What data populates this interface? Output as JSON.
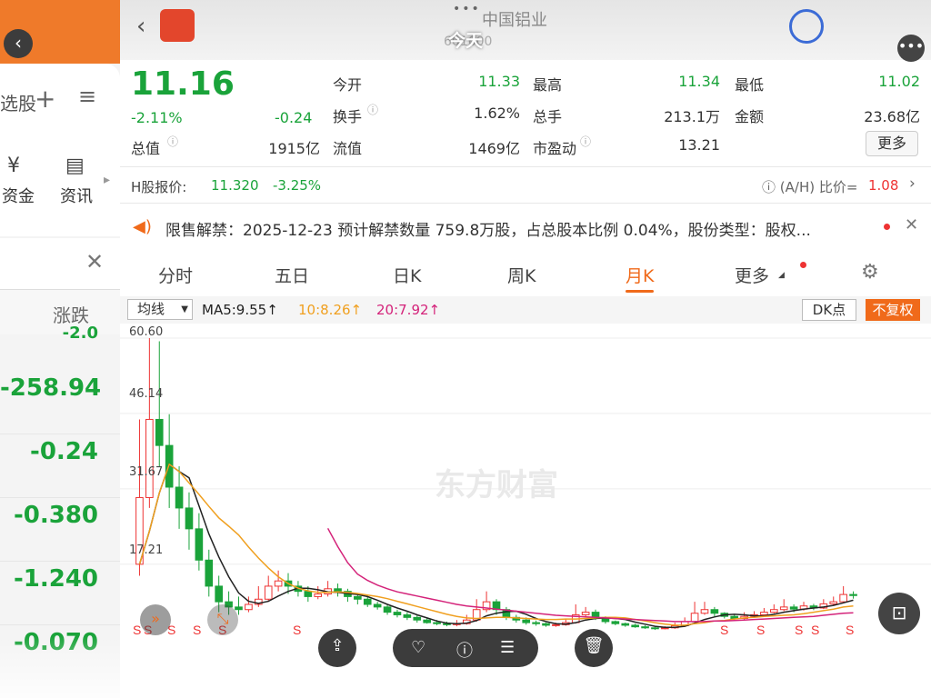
{
  "left_app": {
    "tab_fragment": "选股",
    "icon_funds": "资金",
    "icon_news": "资讯",
    "col_header": "涨跌",
    "values": [
      "-258.94",
      "-0.24",
      "-0.380",
      "-1.240",
      "-0.070"
    ],
    "partial_top_value": "-2.0"
  },
  "header": {
    "title": "今天",
    "stock_name": "中国铝业",
    "stock_code": "601600",
    "sub_code": "601600"
  },
  "quote": {
    "price": "11.16",
    "pct": "-2.11%",
    "change": "-0.24",
    "rows": [
      [
        {
          "label": "今开",
          "value": "11.33",
          "green": true
        },
        {
          "label": "最高",
          "value": "11.34",
          "green": true
        },
        {
          "label": "最低",
          "value": "11.02",
          "green": true
        }
      ],
      [
        {
          "label": "换手",
          "value": "1.62%",
          "green": false
        },
        {
          "label": "总手",
          "value": "213.1万",
          "green": false
        },
        {
          "label": "金额",
          "value": "23.68亿",
          "green": false
        }
      ]
    ],
    "total_value_label": "总值",
    "total_value": "1915亿",
    "float_label": "流值",
    "float_value": "1469亿",
    "pe_label": "市盈动",
    "pe_value": "13.21",
    "more_label": "更多"
  },
  "hshare": {
    "label": "H股报价:",
    "price": "11.320",
    "pct": "-3.25%",
    "ratio_label": "(A/H) 比价=",
    "ratio_value": "1.08"
  },
  "notice": {
    "text": "限售解禁：2025-12-23 预计解禁数量 759.8万股，占总股本比例 0.04%，股份类型：股权..."
  },
  "tabs": [
    "分时",
    "五日",
    "日K",
    "周K",
    "月K",
    "更多"
  ],
  "active_tab": "月K",
  "ma": {
    "selector": "均线",
    "ma5": "MA5:9.55",
    "ma10": "10:8.26",
    "ma20": "20:7.92",
    "dk_label": "DK点",
    "fq_label": "不复权"
  },
  "chart_labels": {
    "watermark": "东方财富",
    "y_ticks": [
      "60.60",
      "46.14",
      "31.67",
      "17.21"
    ],
    "marks": [
      "S",
      "S",
      "S",
      "S",
      "S",
      "S",
      "S",
      "S",
      "S",
      "S",
      "S"
    ]
  },
  "colors": {
    "green": "#1aa33a",
    "red": "#e33",
    "orange": "#f06a1a",
    "ma5": "#222222",
    "ma10": "#f0a020",
    "ma20": "#d4237a"
  },
  "chart_data": {
    "type": "candlestick",
    "ylim": [
      2,
      62
    ],
    "candles": [
      [
        17.2,
        30.0,
        45.0,
        15.0
      ],
      [
        30.0,
        45.0,
        60.6,
        28.0
      ],
      [
        45.0,
        40.0,
        60.0,
        36.0
      ],
      [
        40.0,
        32.0,
        46.0,
        28.0
      ],
      [
        32.0,
        28.0,
        36.0,
        24.0
      ],
      [
        28.0,
        24.0,
        31.0,
        20.0
      ],
      [
        24.0,
        18.0,
        27.0,
        16.0
      ],
      [
        18.0,
        13.0,
        20.0,
        11.0
      ],
      [
        13.0,
        10.0,
        15.0,
        8.0
      ],
      [
        10.0,
        9.0,
        12.0,
        7.5
      ],
      [
        9.0,
        8.5,
        11.0,
        7.5
      ],
      [
        8.5,
        9.5,
        11.0,
        8.0
      ],
      [
        9.5,
        10.5,
        13.0,
        9.0
      ],
      [
        10.5,
        13.0,
        15.0,
        10.0
      ],
      [
        13.0,
        14.0,
        16.0,
        12.0
      ],
      [
        14.0,
        13.0,
        15.5,
        11.5
      ],
      [
        13.0,
        12.0,
        14.0,
        11.0
      ],
      [
        12.0,
        11.0,
        13.0,
        10.0
      ],
      [
        11.0,
        11.5,
        13.0,
        10.5
      ],
      [
        11.5,
        12.5,
        14.0,
        11.0
      ],
      [
        12.5,
        12.0,
        13.5,
        11.0
      ],
      [
        12.0,
        11.0,
        12.5,
        10.0
      ],
      [
        11.0,
        10.5,
        11.5,
        9.5
      ],
      [
        10.5,
        9.5,
        11.0,
        9.0
      ],
      [
        9.5,
        9.0,
        10.0,
        8.5
      ],
      [
        9.0,
        8.0,
        9.5,
        7.5
      ],
      [
        8.0,
        7.5,
        8.5,
        7.0
      ],
      [
        7.5,
        7.0,
        8.0,
        6.5
      ],
      [
        7.0,
        6.5,
        7.5,
        6.0
      ],
      [
        6.5,
        6.0,
        7.0,
        5.8
      ],
      [
        6.0,
        5.8,
        6.5,
        5.5
      ],
      [
        5.8,
        5.6,
        6.2,
        5.3
      ],
      [
        5.6,
        5.8,
        6.5,
        5.3
      ],
      [
        5.8,
        6.5,
        7.5,
        5.6
      ],
      [
        6.5,
        8.5,
        10.5,
        6.2
      ],
      [
        8.5,
        10.0,
        12.0,
        8.0
      ],
      [
        10.0,
        8.5,
        10.5,
        7.5
      ],
      [
        8.5,
        7.0,
        9.0,
        6.5
      ],
      [
        7.0,
        6.5,
        7.5,
        6.0
      ],
      [
        6.5,
        6.0,
        7.0,
        5.6
      ],
      [
        6.0,
        5.8,
        6.4,
        5.4
      ],
      [
        5.8,
        5.5,
        6.0,
        5.2
      ],
      [
        5.5,
        5.6,
        6.0,
        5.2
      ],
      [
        5.6,
        6.0,
        6.8,
        5.4
      ],
      [
        6.0,
        7.5,
        9.5,
        5.8
      ],
      [
        7.5,
        8.0,
        9.0,
        7.0
      ],
      [
        8.0,
        7.0,
        8.5,
        6.5
      ],
      [
        7.0,
        6.2,
        7.2,
        5.8
      ],
      [
        6.2,
        5.8,
        6.4,
        5.5
      ],
      [
        5.8,
        5.5,
        6.0,
        5.2
      ],
      [
        5.5,
        5.2,
        5.8,
        5.0
      ],
      [
        5.2,
        5.0,
        5.5,
        4.8
      ],
      [
        5.0,
        4.9,
        5.2,
        4.6
      ],
      [
        4.9,
        5.0,
        5.3,
        4.7
      ],
      [
        5.0,
        5.4,
        6.0,
        4.8
      ],
      [
        5.4,
        6.2,
        7.0,
        5.2
      ],
      [
        6.2,
        7.8,
        10.0,
        6.0
      ],
      [
        7.8,
        8.5,
        10.0,
        7.5
      ],
      [
        8.5,
        7.8,
        9.0,
        7.2
      ],
      [
        7.8,
        7.2,
        8.0,
        6.8
      ],
      [
        7.2,
        6.8,
        7.5,
        6.4
      ],
      [
        6.8,
        7.2,
        8.0,
        6.5
      ],
      [
        7.2,
        7.5,
        8.2,
        7.0
      ],
      [
        7.5,
        8.0,
        8.8,
        7.2
      ],
      [
        8.0,
        8.5,
        9.5,
        7.8
      ],
      [
        8.5,
        9.0,
        10.5,
        8.2
      ],
      [
        9.0,
        8.6,
        9.5,
        8.0
      ],
      [
        8.6,
        9.2,
        10.0,
        8.3
      ],
      [
        9.2,
        8.8,
        9.6,
        8.4
      ],
      [
        8.8,
        9.6,
        10.5,
        8.6
      ],
      [
        9.6,
        10.0,
        11.0,
        9.3
      ],
      [
        10.0,
        11.4,
        13.0,
        9.8
      ],
      [
        11.4,
        11.2,
        12.0,
        10.6
      ]
    ],
    "ma_series": [
      {
        "name": "MA5",
        "values": [
          17.2,
          23.6,
          30.9,
          36.4,
          35.0,
          33.8,
          28.4,
          23.0,
          18.6,
          14.8,
          11.7,
          10.1,
          9.7,
          10.1,
          11.1,
          12.0,
          12.6,
          12.6,
          12.3,
          11.9,
          11.8,
          11.6,
          11.4,
          11.0,
          10.3,
          9.5,
          8.8,
          8.2,
          7.5,
          6.9,
          6.3,
          5.9,
          5.8,
          5.9,
          6.4,
          7.3,
          7.8,
          8.1,
          8.2,
          7.6,
          6.8,
          6.2,
          5.8,
          5.7,
          6.0,
          6.5,
          6.8,
          6.9,
          6.8,
          6.6,
          6.1,
          5.7,
          5.3,
          5.1,
          5.1,
          5.3,
          5.9,
          6.6,
          7.1,
          7.5,
          7.6,
          7.5,
          7.3,
          7.3,
          7.6,
          8.0,
          8.3,
          8.6,
          8.8,
          9.0,
          9.3,
          9.8,
          10.3
        ]
      },
      {
        "name": "MA10",
        "values": [
          17.2,
          23.6,
          30.9,
          36.4,
          35.0,
          32.8,
          30.6,
          28.3,
          26.1,
          24.5,
          22.8,
          20.5,
          18.4,
          16.5,
          14.8,
          13.5,
          12.6,
          12.1,
          11.8,
          11.8,
          11.9,
          11.8,
          11.6,
          11.3,
          11.0,
          10.6,
          10.1,
          9.6,
          9.1,
          8.6,
          8.1,
          7.6,
          7.2,
          6.9,
          6.8,
          6.9,
          7.0,
          7.0,
          6.9,
          6.8,
          6.7,
          6.6,
          6.6,
          6.7,
          6.7,
          6.8,
          6.9,
          7.0,
          7.0,
          6.9,
          6.6,
          6.3,
          6.0,
          5.7,
          5.5,
          5.5,
          5.8,
          6.0,
          6.3,
          6.4,
          6.7,
          6.9,
          7.0,
          7.2,
          7.3,
          7.4,
          7.5,
          7.7,
          8.0,
          8.3,
          8.6,
          9.0,
          9.2
        ]
      },
      {
        "name": "MA20",
        "values": [
          null,
          null,
          null,
          null,
          null,
          null,
          null,
          null,
          null,
          null,
          null,
          null,
          null,
          null,
          null,
          null,
          null,
          null,
          null,
          24.1,
          20.6,
          17.5,
          15.3,
          14.1,
          13.2,
          12.5,
          11.9,
          11.5,
          11.1,
          10.7,
          10.3,
          9.9,
          9.5,
          9.2,
          9.0,
          8.8,
          8.6,
          8.4,
          8.2,
          8.0,
          7.8,
          7.6,
          7.4,
          7.3,
          7.2,
          7.1,
          7.0,
          6.9,
          6.8,
          6.7,
          6.6,
          6.5,
          6.4,
          6.3,
          6.2,
          6.2,
          6.2,
          6.2,
          6.3,
          6.3,
          6.4,
          6.5,
          6.6,
          6.7,
          6.8,
          6.9,
          7.0,
          7.1,
          7.2,
          7.4,
          7.6,
          7.8,
          7.9
        ]
      }
    ]
  }
}
